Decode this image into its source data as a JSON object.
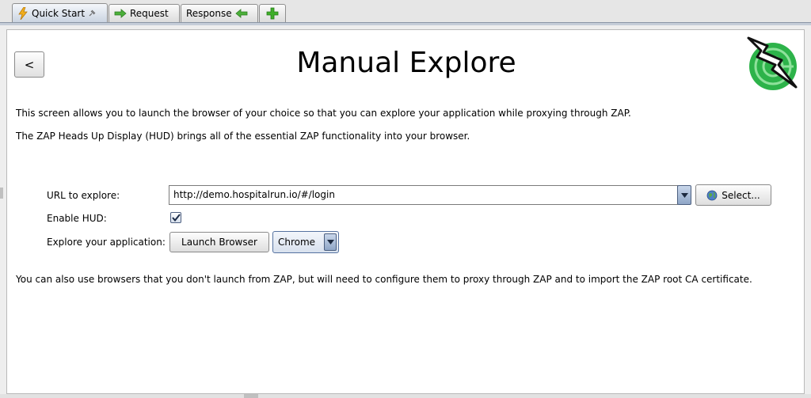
{
  "tabs": [
    {
      "label": "Quick Start",
      "icon": "lightning-icon",
      "pinned": true
    },
    {
      "label": "Request",
      "icon": "arrow-right-icon"
    },
    {
      "label": "Response",
      "icon": "arrow-left-icon"
    },
    {
      "label": "",
      "icon": "plus-icon"
    }
  ],
  "page": {
    "title": "Manual Explore",
    "back_label": "<",
    "description_1": "This screen allows you to launch the browser of your choice so that you can explore your application while proxying through ZAP.",
    "description_2": "The ZAP Heads Up Display (HUD) brings all of the essential ZAP functionality into your browser.",
    "footer_text": "You can also use browsers that you don't launch from ZAP, but will need to configure them to proxy through ZAP and to import the ZAP root CA certificate."
  },
  "form": {
    "url_label": "URL to explore:",
    "url_value": "http://demo.hospitalrun.io/#/login",
    "select_label": "Select...",
    "hud_label": "Enable HUD:",
    "hud_checked": true,
    "explore_label": "Explore your application:",
    "launch_label": "Launch Browser",
    "browser_value": "Chrome"
  },
  "colors": {
    "logo_green": "#2db34a",
    "arrow_green": "#3aa53a",
    "accent_blue": "#8fa6c7"
  }
}
